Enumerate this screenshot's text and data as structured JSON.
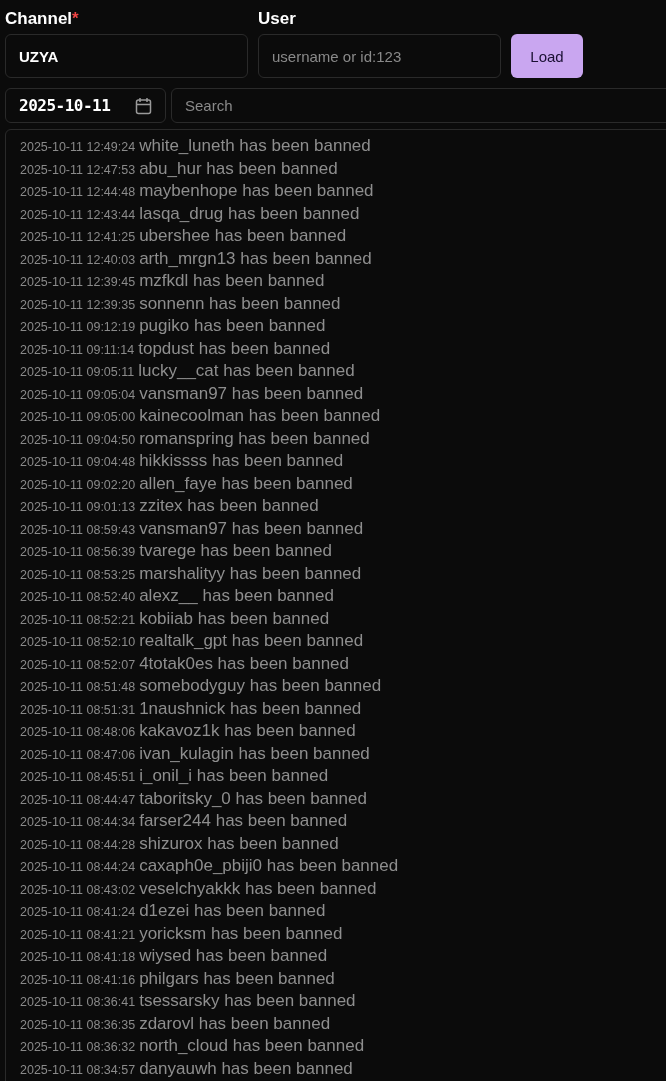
{
  "channel": {
    "label": "Channel",
    "required_mark": "*",
    "value": "UZYA"
  },
  "user": {
    "label": "User",
    "placeholder": "username or id:123"
  },
  "load_button": "Load",
  "date": {
    "value": "2025-10-11"
  },
  "search": {
    "placeholder": "Search"
  },
  "log": [
    {
      "time": "2025-10-11 12:49:24",
      "message": "white_luneth has been banned"
    },
    {
      "time": "2025-10-11 12:47:53",
      "message": "abu_hur has been banned"
    },
    {
      "time": "2025-10-11 12:44:48",
      "message": "maybenhope has been banned"
    },
    {
      "time": "2025-10-11 12:43:44",
      "message": "lasqa_drug has been banned"
    },
    {
      "time": "2025-10-11 12:41:25",
      "message": "ubershee has been banned"
    },
    {
      "time": "2025-10-11 12:40:03",
      "message": "arth_mrgn13 has been banned"
    },
    {
      "time": "2025-10-11 12:39:45",
      "message": "mzfkdl has been banned"
    },
    {
      "time": "2025-10-11 12:39:35",
      "message": "sonnenn has been banned"
    },
    {
      "time": "2025-10-11 09:12:19",
      "message": "pugiko has been banned"
    },
    {
      "time": "2025-10-11 09:11:14",
      "message": "topdust has been banned"
    },
    {
      "time": "2025-10-11 09:05:11",
      "message": "lucky__cat has been banned"
    },
    {
      "time": "2025-10-11 09:05:04",
      "message": "vansman97 has been banned"
    },
    {
      "time": "2025-10-11 09:05:00",
      "message": "kainecoolman has been banned"
    },
    {
      "time": "2025-10-11 09:04:50",
      "message": "romanspring has been banned"
    },
    {
      "time": "2025-10-11 09:04:48",
      "message": "hikkissss has been banned"
    },
    {
      "time": "2025-10-11 09:02:20",
      "message": "allen_faye has been banned"
    },
    {
      "time": "2025-10-11 09:01:13",
      "message": "zzitex has been banned"
    },
    {
      "time": "2025-10-11 08:59:43",
      "message": "vansman97 has been banned"
    },
    {
      "time": "2025-10-11 08:56:39",
      "message": "tvarege has been banned"
    },
    {
      "time": "2025-10-11 08:53:25",
      "message": "marshalityy has been banned"
    },
    {
      "time": "2025-10-11 08:52:40",
      "message": "alexz__ has been banned"
    },
    {
      "time": "2025-10-11 08:52:21",
      "message": "kobiiab has been banned"
    },
    {
      "time": "2025-10-11 08:52:10",
      "message": "realtalk_gpt has been banned"
    },
    {
      "time": "2025-10-11 08:52:07",
      "message": "4totak0es has been banned"
    },
    {
      "time": "2025-10-11 08:51:48",
      "message": "somebodyguy has been banned"
    },
    {
      "time": "2025-10-11 08:51:31",
      "message": "1naushnick has been banned"
    },
    {
      "time": "2025-10-11 08:48:06",
      "message": "kakavoz1k has been banned"
    },
    {
      "time": "2025-10-11 08:47:06",
      "message": "ivan_kulagin has been banned"
    },
    {
      "time": "2025-10-11 08:45:51",
      "message": "i_onil_i has been banned"
    },
    {
      "time": "2025-10-11 08:44:47",
      "message": "taboritsky_0 has been banned"
    },
    {
      "time": "2025-10-11 08:44:34",
      "message": "farser244 has been banned"
    },
    {
      "time": "2025-10-11 08:44:28",
      "message": "shizurox has been banned"
    },
    {
      "time": "2025-10-11 08:44:24",
      "message": "caxaph0e_pbiji0 has been banned"
    },
    {
      "time": "2025-10-11 08:43:02",
      "message": "veselchyakkk has been banned"
    },
    {
      "time": "2025-10-11 08:41:24",
      "message": "d1ezei has been banned"
    },
    {
      "time": "2025-10-11 08:41:21",
      "message": "yoricksm has been banned"
    },
    {
      "time": "2025-10-11 08:41:18",
      "message": "wiysed has been banned"
    },
    {
      "time": "2025-10-11 08:41:16",
      "message": "philgars has been banned"
    },
    {
      "time": "2025-10-11 08:36:41",
      "message": "tsessarsky has been banned"
    },
    {
      "time": "2025-10-11 08:36:35",
      "message": "zdarovl has been banned"
    },
    {
      "time": "2025-10-11 08:36:32",
      "message": "north_cloud has been banned"
    },
    {
      "time": "2025-10-11 08:34:57",
      "message": "danyauwh has been banned"
    }
  ]
}
